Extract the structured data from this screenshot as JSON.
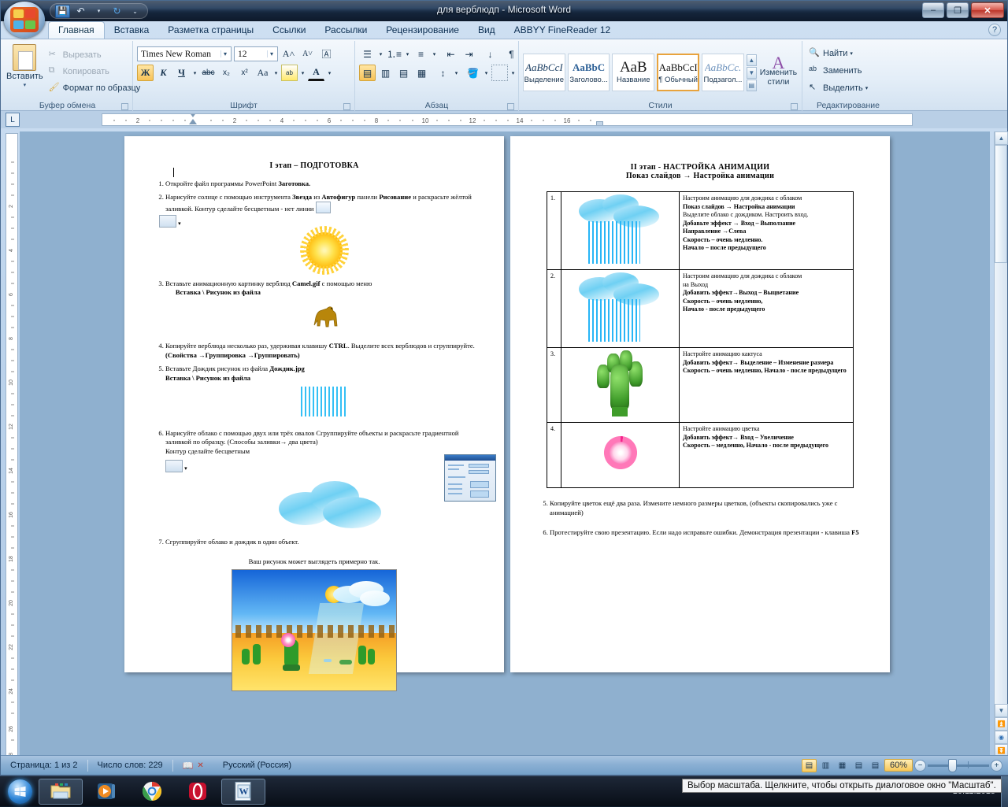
{
  "window": {
    "title": "для верблюдп - Microsoft Word",
    "minimize": "–",
    "restore": "❐",
    "close": "✕"
  },
  "quick_access": {
    "save": "save-icon",
    "undo": "undo-icon",
    "redo": "redo-icon",
    "customize": "customize-icon"
  },
  "tabs": [
    {
      "label": "Главная",
      "active": true
    },
    {
      "label": "Вставка",
      "active": false
    },
    {
      "label": "Разметка страницы",
      "active": false
    },
    {
      "label": "Ссылки",
      "active": false
    },
    {
      "label": "Рассылки",
      "active": false
    },
    {
      "label": "Рецензирование",
      "active": false
    },
    {
      "label": "Вид",
      "active": false
    },
    {
      "label": "ABBYY FineReader 12",
      "active": false
    }
  ],
  "help_button": "?",
  "ribbon": {
    "clipboard": {
      "label": "Буфер обмена",
      "paste": "Вставить",
      "cut": "Вырезать",
      "copy": "Копировать",
      "format_painter": "Формат по образцу",
      "dialog_launcher": "◢"
    },
    "font": {
      "label": "Шрифт",
      "font_name": "Times New Roman",
      "font_size": "12",
      "grow_font": "A˄",
      "shrink_font": "A˅",
      "clear_format": "clear-formatting-icon",
      "bold": "Ж",
      "italic": "К",
      "underline": "Ч",
      "strikethrough": "abc",
      "subscript": "x₂",
      "superscript": "x²",
      "change_case": "Aa",
      "highlight": "highlight-icon",
      "font_color": "A",
      "dialog_launcher": "◢"
    },
    "paragraph": {
      "label": "Абзац",
      "bullets": "bullets-icon",
      "numbering": "numbering-icon",
      "multilevel": "multilevel-list-icon",
      "decrease_indent": "decrease-indent-icon",
      "increase_indent": "increase-indent-icon",
      "sort": "sort-icon",
      "show_marks": "¶",
      "align_left": "align-left-icon",
      "align_center": "align-center-icon",
      "align_right": "align-right-icon",
      "justify": "justify-icon",
      "line_spacing": "line-spacing-icon",
      "shading": "shading-icon",
      "borders": "borders-icon",
      "dialog_launcher": "◢"
    },
    "styles": {
      "label": "Стили",
      "items": [
        {
          "sample": "AaBbCcI",
          "name": "Выделение",
          "selected": false
        },
        {
          "sample": "AaBbC",
          "name": "Заголово...",
          "selected": false
        },
        {
          "sample": "АаВ",
          "name": "Название",
          "selected": false
        },
        {
          "sample": "AaBbCcI",
          "name": "¶ Обычный",
          "selected": true
        },
        {
          "sample": "AaBbCc.",
          "name": "Подзагол...",
          "selected": false
        }
      ],
      "change_styles": "Изменить стили",
      "dialog_launcher": "◢"
    },
    "editing": {
      "label": "Редактирование",
      "find": "Найти",
      "replace": "Заменить",
      "select": "Выделить"
    }
  },
  "ruler": {
    "tab_stop": "L",
    "h_marks": [
      "2",
      "2",
      "4",
      "6",
      "8",
      "10",
      "12",
      "14",
      "16"
    ],
    "v_marks": [
      "2",
      "4",
      "6",
      "8",
      "10",
      "12",
      "14",
      "16",
      "18",
      "20",
      "22",
      "24",
      "26",
      "28"
    ]
  },
  "document": {
    "left_page": {
      "title": "I этап – ПОДГОТОВКА",
      "items": [
        {
          "n": "1.",
          "text": "Откройте файл  программы PowerPoint <b>Заготовка.</b>"
        },
        {
          "n": "2.",
          "text": "Нарисуйте солнце с помощью инструмента <b>Звезда</b>  из <b>Автофигур</b> панели <b>Рисование</b> и раскрасьте жёлтой заливкой.   Контур сделайте бесцветным - нет линии"
        },
        {
          "n": "3.",
          "text": "Вставьте анимационную картинку верблюд  <b>Camel.gif</b> с помощью меню<br><b>&nbsp;&nbsp;&nbsp;&nbsp;&nbsp;&nbsp;Вставка \\  Рисунок из файла</b>"
        },
        {
          "n": "4.",
          "text": "Копируйте верблюда несколько раз, удерживая клавишу <b>CTRL</b>. Выделите всех верблюдов и  сгруппируйте.<br><b>(Свойства →Группировка →Группировать)</b>"
        },
        {
          "n": "5.",
          "text": "Вставьте Дождик рисунок из файла <b>Дождик.jpg</b><br><b>Вставка \\  Рисунок из файла</b>"
        },
        {
          "n": "6.",
          "text": "Нарисуйте облако с помощью двух  или трёх овалов      Сгруппируйте объекты и раскрасьте градиентной заливкой по образцу. (Способы заливки→ два цвета)<br>Контур сделайте бесцветным"
        },
        {
          "n": "7.",
          "text": "Сгруппируйте облако и дождик в один объект."
        }
      ],
      "caption": "Ваш рисунок может выглядеть примерно так."
    },
    "right_page": {
      "title_line1": "II этап -  НАСТРОЙКА АНИМАЦИИ",
      "title_line2": "Показ слайдов → Настройка анимации",
      "table": [
        {
          "num": "1.",
          "image": "rain-cloud-icon",
          "lines": [
            {
              "t": "Настроим анимацию  для дождика с облаком",
              "b": false
            },
            {
              "t": " Показ слайдов → Настройка анимации",
              "b": true
            },
            {
              "t": "Выделите облако с дождиком. Настроить вход.",
              "b": false
            },
            {
              "t": "Добавьте эффект → Вход – Выползание",
              "b": true
            },
            {
              "t": "Направление →Слева",
              "b": true
            },
            {
              "t": "Скорость – очень медленно.",
              "b": true
            },
            {
              "t": "Начало – после предыдущего",
              "b": true
            }
          ]
        },
        {
          "num": "2.",
          "image": "rain-cloud-icon",
          "lines": [
            {
              "t": "Настроим анимацию  для дождика с облаком",
              "b": false
            },
            {
              "t": " на Выход",
              "b": false
            },
            {
              "t": "Добавить эффект→Выход – Выцветание",
              "b": true
            },
            {
              "t": "Скорость – очень медленно,",
              "b": true
            },
            {
              "t": "Начало - после предыдущего",
              "b": true
            }
          ]
        },
        {
          "num": "3.",
          "image": "cactus-icon",
          "lines": [
            {
              "t": "Настройте анимацию кактуса",
              "b": false
            },
            {
              "t": "Добавить эффект→ Выделение – Изменение размера",
              "b": true
            },
            {
              "t": " Скорость – очень медленно, Начало - после предыдущего",
              "b": true
            }
          ]
        },
        {
          "num": "4.",
          "image": "flower-icon",
          "lines": [
            {
              "t": " Настройте анимацию цветка",
              "b": false
            },
            {
              "t": "Добавить эффект→ Вход – Увеличение",
              "b": true
            },
            {
              "t": "Скорость –  медленно, Начало - после предыдущего",
              "b": true
            }
          ]
        }
      ],
      "items": [
        {
          "n": "5.",
          "text": "Копируйте цветок ещё два раза. Измените  немного размеры цветков, (объекты скопировались уже с анимацией)"
        },
        {
          "n": "6.",
          "text": "Протестируйте свою презентацию. Если надо исправьте ошибки. Демонстрация презентации - клавиша <b>F5</b>"
        }
      ]
    }
  },
  "status_bar": {
    "page": "Страница: 1 из 2",
    "words": "Число слов: 229",
    "proofing": "proofing-errors-icon",
    "language": "Русский (Россия)",
    "views": [
      {
        "name": "print-layout-view",
        "glyph": "▤",
        "active": true
      },
      {
        "name": "full-screen-reading-view",
        "glyph": "▥",
        "active": false
      },
      {
        "name": "web-layout-view",
        "glyph": "▦",
        "active": false
      },
      {
        "name": "outline-view",
        "glyph": "▤",
        "active": false
      },
      {
        "name": "draft-view",
        "glyph": "▤",
        "active": false
      }
    ],
    "zoom": "60%",
    "zoom_out": "−",
    "zoom_in": "+"
  },
  "tooltip": "Выбор масштаба. Щелкните, чтобы открыть диалоговое окно \"Масштаб\".",
  "taskbar": {
    "start": "start-orb-icon",
    "items": [
      {
        "name": "windows-explorer-icon",
        "open": true
      },
      {
        "name": "media-player-icon",
        "open": false
      },
      {
        "name": "google-chrome-icon",
        "open": false
      },
      {
        "name": "opera-browser-icon",
        "open": false
      },
      {
        "name": "microsoft-word-icon",
        "open": true
      }
    ],
    "date": "10.11.2015"
  }
}
